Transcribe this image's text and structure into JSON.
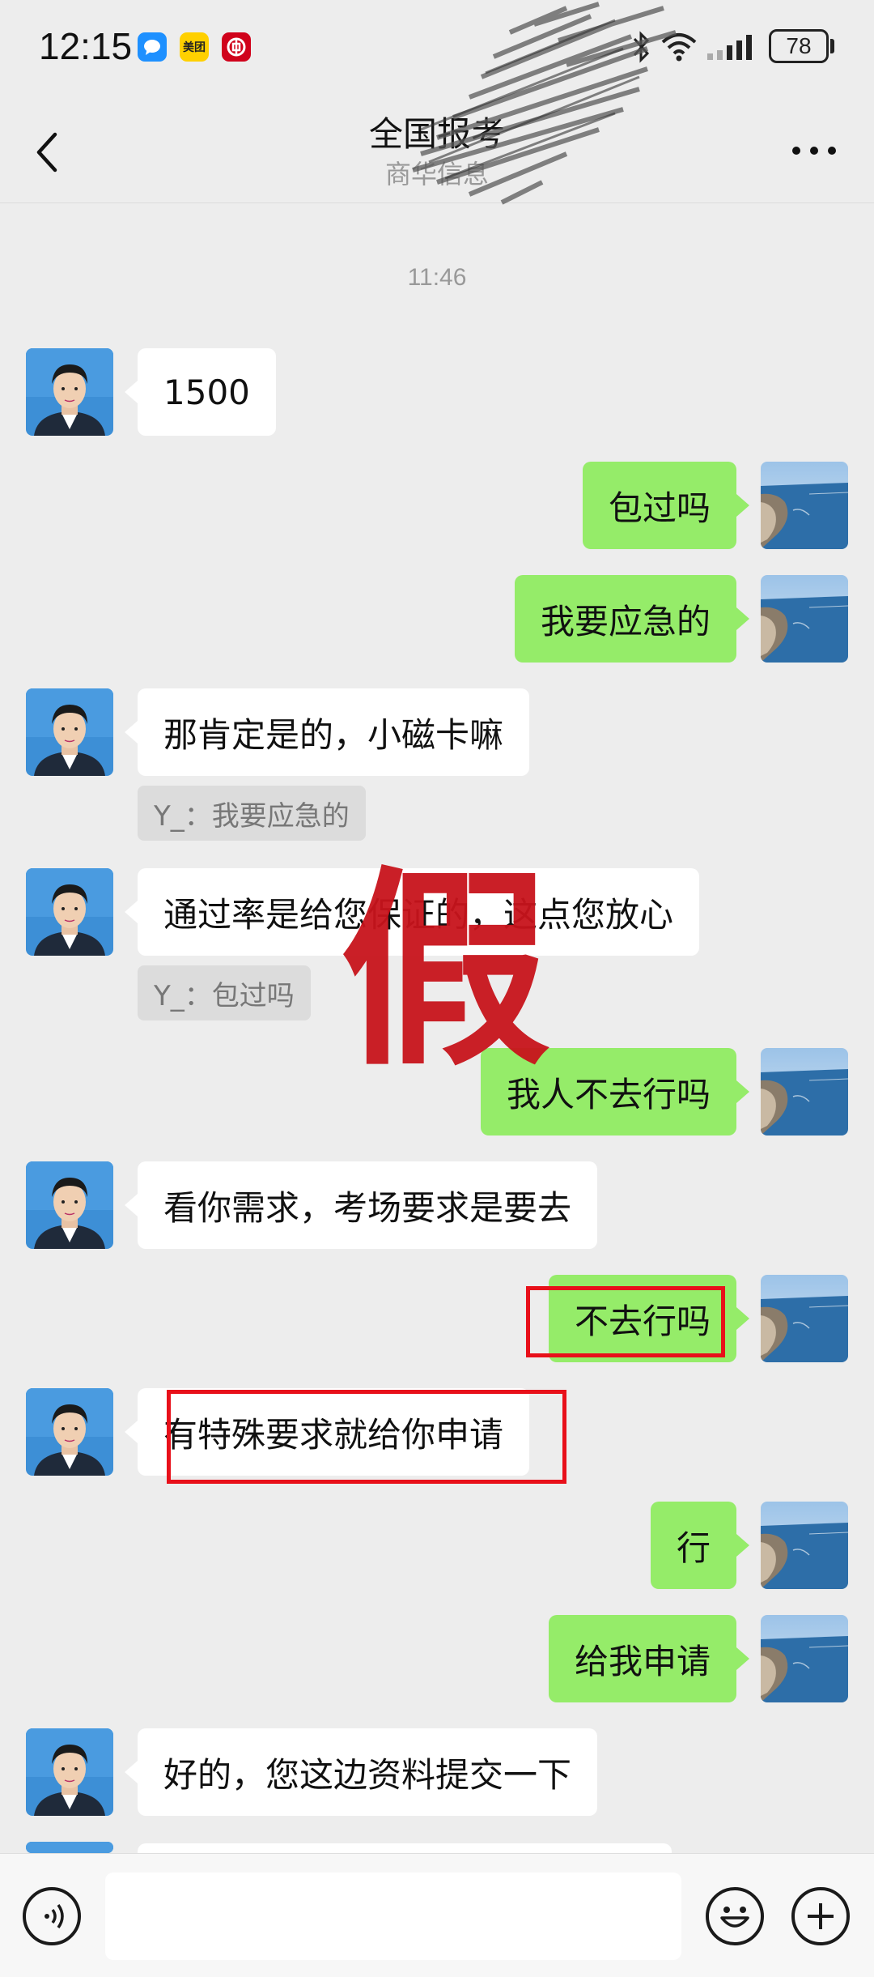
{
  "status_bar": {
    "time": "12:15",
    "apps": [
      "message-app-icon",
      "meituan-app-icon",
      "bank-app-icon"
    ],
    "meituan_label": "美团",
    "battery": "78"
  },
  "header": {
    "title": "全国报考",
    "subtitle": "商华信息",
    "more": "···"
  },
  "timestamp": "11:46",
  "messages": [
    {
      "side": "in",
      "text": "1500"
    },
    {
      "side": "out",
      "text": "包过吗"
    },
    {
      "side": "out",
      "text": "我要应急的"
    },
    {
      "side": "in",
      "text": "那肯定是的，小磁卡嘛",
      "quote": "Y_：我要应急的"
    },
    {
      "side": "in",
      "text": "通过率是给您保证的，这点您放心",
      "quote": "Y_：包过吗"
    },
    {
      "side": "out",
      "text": "我人不去行吗"
    },
    {
      "side": "in",
      "text": "看你需求，考场要求是要去"
    },
    {
      "side": "out",
      "text": "不去行吗"
    },
    {
      "side": "in",
      "text": "有特殊要求就给你申请"
    },
    {
      "side": "out",
      "text": "行"
    },
    {
      "side": "out",
      "text": "给我申请"
    },
    {
      "side": "in",
      "text": "好的，您这边资料提交一下"
    }
  ],
  "watermark": "假",
  "colors": {
    "outgoing": "#95ec69",
    "incoming": "#ffffff",
    "highlight": "#e8101a",
    "background": "#ededed"
  },
  "input_bar": {
    "voice": "voice-icon",
    "emoji": "emoji-icon",
    "add": "add-icon",
    "input_value": ""
  }
}
